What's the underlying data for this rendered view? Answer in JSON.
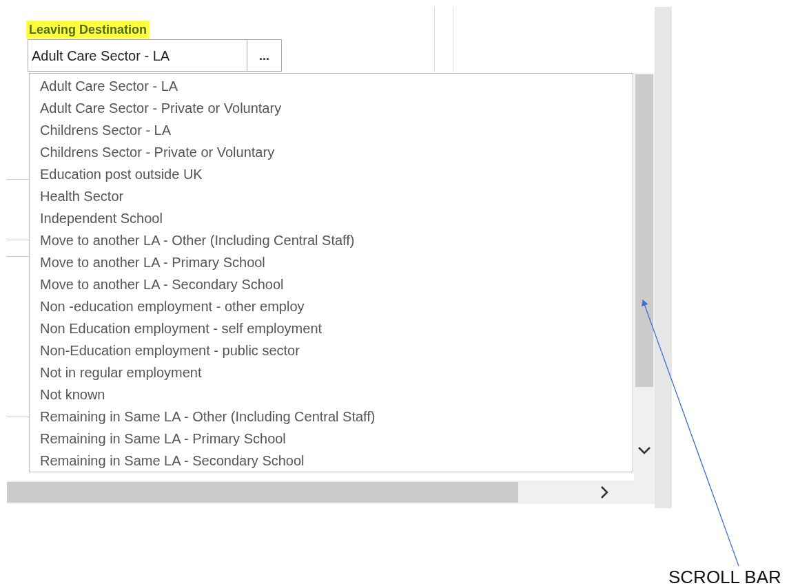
{
  "field": {
    "label": "Leaving Destination",
    "value": "Adult Care Sector - LA",
    "button_text": "..."
  },
  "options": [
    "Adult Care Sector - LA",
    "Adult Care Sector - Private or Voluntary",
    "Childrens Sector - LA",
    "Childrens Sector - Private or Voluntary",
    "Education post outside UK",
    "Health Sector",
    "Independent School",
    "Move to another LA - Other (Including Central Staff)",
    "Move to another LA - Primary School",
    "Move to another LA - Secondary School",
    "Non -education employment - other employ",
    "Non Education employment - self employment",
    "Non-Education employment - public sector",
    "Not in regular employment",
    "Not known",
    "Remaining in Same LA - Other (Including Central Staff)",
    "Remaining in Same LA - Primary School",
    "Remaining in Same LA - Secondary School"
  ],
  "annotation": {
    "text": "SCROLL BAR"
  }
}
